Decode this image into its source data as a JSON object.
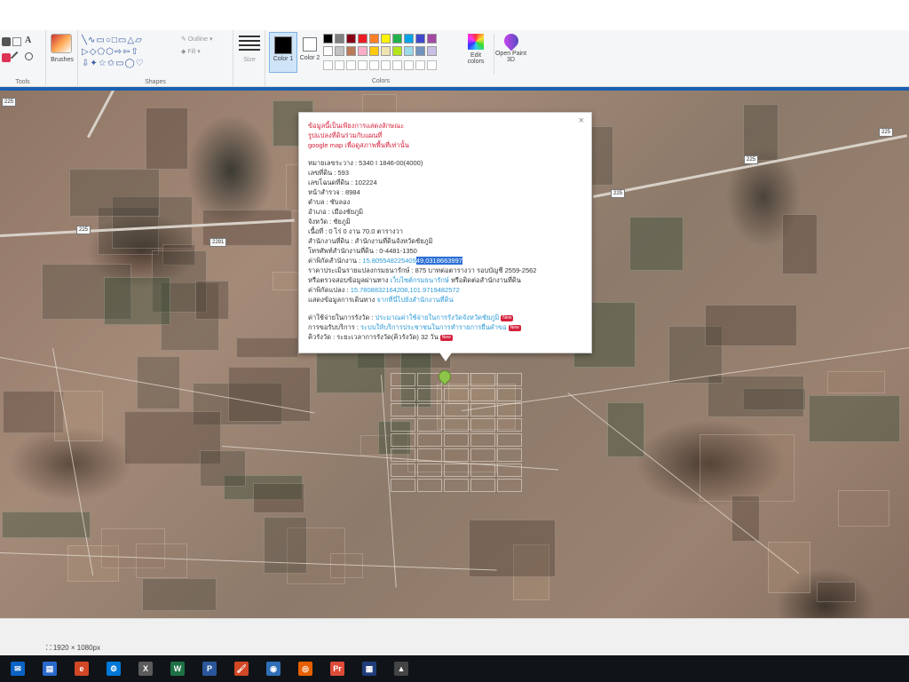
{
  "ribbon": {
    "tools_label": "Tools",
    "brushes_label": "Brushes",
    "shapes_label": "Shapes",
    "outline_label": "Outline",
    "fill_label": "Fill",
    "size_label": "Size",
    "color1_label": "Color 1",
    "color2_label": "Color 2",
    "colors_label": "Colors",
    "edit_colors_label": "Edit colors",
    "open_paint3d_label": "Open Paint 3D",
    "palette": [
      "#000000",
      "#7f7f7f",
      "#880015",
      "#ed1c24",
      "#ff7f27",
      "#fff200",
      "#22b14c",
      "#00a2e8",
      "#3f48cc",
      "#a349a4",
      "#ffffff",
      "#c3c3c3",
      "#b97a57",
      "#ffaec9",
      "#ffc90e",
      "#efe4b0",
      "#b5e61d",
      "#99d9ea",
      "#7092be",
      "#c8bfe7"
    ]
  },
  "map": {
    "road_signs": [
      "225",
      "2281",
      "225",
      "225",
      "225",
      "225",
      "225"
    ]
  },
  "popup": {
    "header_lines": [
      "ข้อมูลนี้เป็นเพียงการแสดงลักษณะ",
      "รูปแปลงที่ดินร่วมกับแผนที่",
      "google map เพื่อดูสภาพพื้นที่เท่านั้น"
    ],
    "rows": [
      "หมายเลขระวาง : 5340 I 1846-00(4000)",
      "เลขที่ดิน : 593",
      "เลขโฉนดที่ดิน : 102224",
      "หน้าสำรวจ : 8984",
      "ตำบล : ซับลอง",
      "อำเภอ : เมืองชัยภูมิ",
      "จังหวัด : ชัยภูมิ",
      "เนื้อที่ : 0 ไร่ 0 งาน 70.0 ตารางวา",
      "สำนักงานที่ดิน : สำนักงานที่ดินจังหวัดชัยภูมิ",
      "โทรศัพท์สำนักงานที่ดิน : 0-4481-1350"
    ],
    "office_coord_label": "ค่าพิกัดสำนักงาน : ",
    "office_coord_a": "15.805548225409",
    "office_coord_b": "49,0318663997",
    "appraisal_line": "ราคาประเมินรายแปลงกรมธนารักษ์ : 875 บาทต่อตารางวา รอบบัญชี 2559-2562",
    "check_prefix": "หรือตรวจสอบข้อมูลผ่านทาง ",
    "check_link": "เว็บไซต์กรมธนารักษ์",
    "check_suffix": " หรือติดต่อสำนักงานที่ดิน",
    "parcel_coord_label": "ค่าพิกัดแปลง : ",
    "parcel_coord_value": "15.7808832164208,101.9719482572",
    "route_prefix": "แสดงข้อมูลการเดินทาง ",
    "route_link": "จากที่นี่ไปยังสำนักงานที่ดิน",
    "fee_label": "ค่าใช้จ่ายในการรังวัด : ",
    "fee_link": "ประมาณค่าใช้จ่ายในการรังวัดจังหวัดชัยภูมิ",
    "service_label": "การขอรับบริการ : ",
    "service_link": "ระบบให้บริการประชาชนในการทำรายการยื่นคำขอ",
    "survey_line": "คิวรังวัด : ระยะเวลาการรังวัด(คิวรังวัด) 32 วัน",
    "new_badge": "New",
    "close_symbol": "×"
  },
  "statusbar": {
    "dimensions": "1920 × 1080px"
  },
  "taskbar": {
    "icons": [
      "mail-icon",
      "explorer-icon",
      "edge-icon",
      "settings-icon",
      "excel-icon",
      "word-icon",
      "powerpoint-icon",
      "paint-icon",
      "firefox-icon",
      "chrome-icon",
      "premiere-icon",
      "calculator-icon",
      "photos-icon"
    ],
    "letters": [
      "✉",
      "▤",
      "e",
      "⚙",
      "X",
      "W",
      "P",
      "🖌",
      "◉",
      "◎",
      "Pr",
      "▦",
      "▲"
    ]
  }
}
